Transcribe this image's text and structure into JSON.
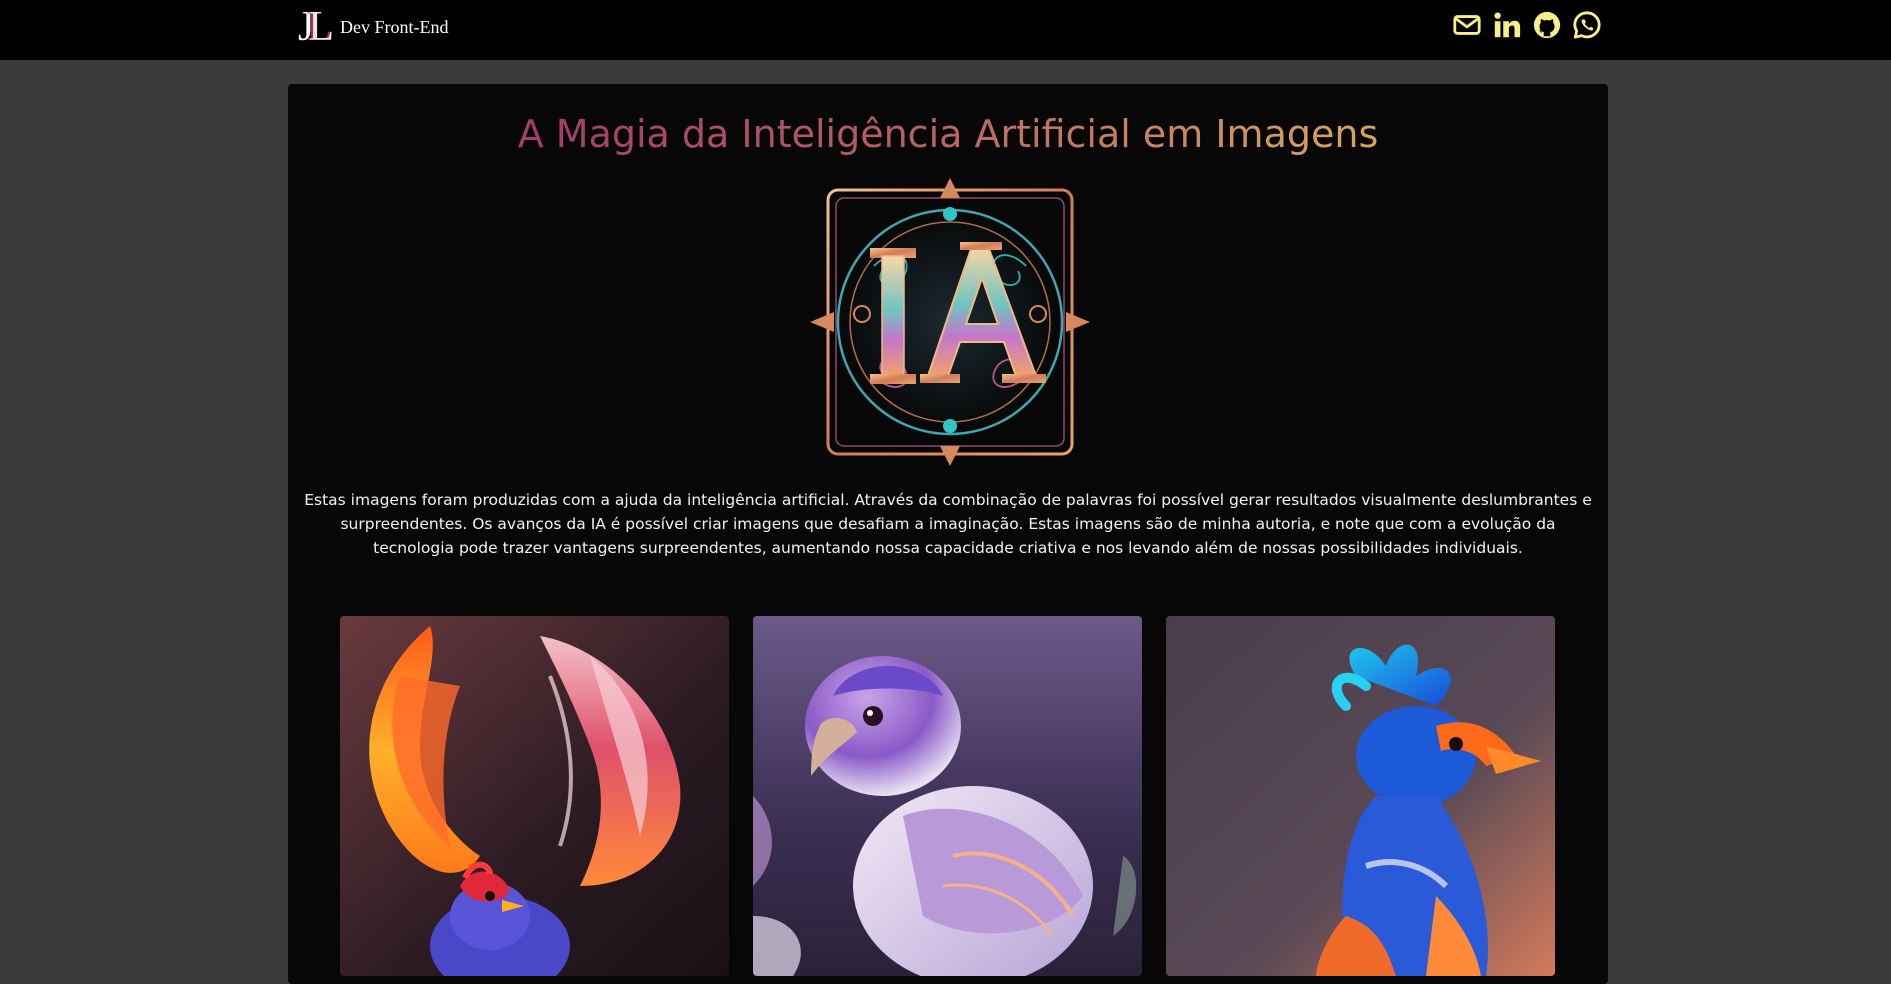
{
  "header": {
    "logo_text": "JL",
    "brand_label": "Dev Front-End",
    "social": [
      {
        "name": "email",
        "icon": "envelope-icon"
      },
      {
        "name": "linkedin",
        "icon": "linkedin-icon"
      },
      {
        "name": "github",
        "icon": "github-icon"
      },
      {
        "name": "whatsapp",
        "icon": "whatsapp-icon"
      }
    ],
    "icon_color": "#f7f08a"
  },
  "main": {
    "title": "A Magia da Inteligência Artificial em Imagens",
    "hero_emblem_text": "IA",
    "description": "Estas imagens foram produzidas com a ajuda da inteligência artificial. Através da combinação de palavras foi possível gerar resultados visualmente deslumbrantes e surpreendentes. Os avanços da IA é possível criar imagens que desafiam a imaginação. Estas imagens são de minha autoria, e note que com a evolução da tecnologia pode trazer vantagens surpreendentes, aumentando nossa capacidade criativa e nos levando além de nossas possibilidades individuais.",
    "gallery": [
      {
        "subject": "phoenix-bird-image"
      },
      {
        "subject": "lilac-bird-image"
      },
      {
        "subject": "blue-crested-bird-image"
      }
    ]
  },
  "colors": {
    "page_background": "#3a3a3a",
    "topbar": "#000000",
    "card": "#070707",
    "title_gradient": [
      "#a23f6a",
      "#d4a25f"
    ]
  }
}
